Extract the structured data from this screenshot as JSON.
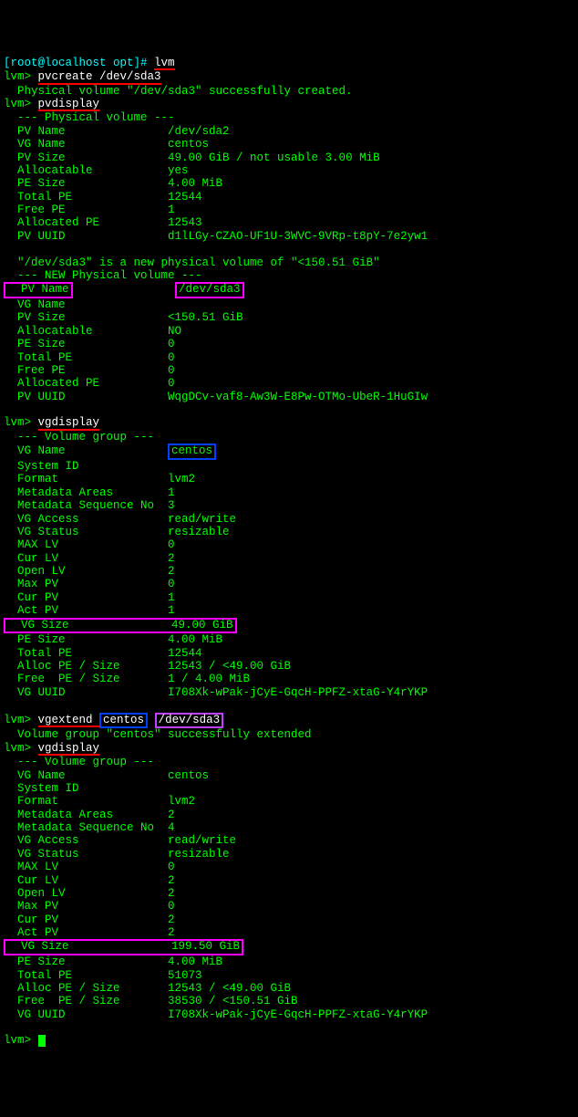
{
  "line1_prompt": "[root@localhost opt]# ",
  "line1_cmd": "lvm",
  "lvm_prompt": "lvm> ",
  "cmd_pvcreate": "pvcreate /dev/sda3",
  "pvcreate_msg": "  Physical volume \"/dev/sda3\" successfully created.",
  "cmd_pvdisplay": "pvdisplay",
  "pv1_header": "  --- Physical volume ---",
  "pv1_name_l": "  PV Name               ",
  "pv1_name_v": "/dev/sda2",
  "pv1_vg_l": "  VG Name               ",
  "pv1_vg_v": "centos",
  "pv1_size_l": "  PV Size               ",
  "pv1_size_v": "49.00 GiB / not usable 3.00 MiB",
  "pv1_alloc_l": "  Allocatable           ",
  "pv1_alloc_v": "yes",
  "pv1_pesize_l": "  PE Size               ",
  "pv1_pesize_v": "4.00 MiB",
  "pv1_totpe_l": "  Total PE              ",
  "pv1_totpe_v": "12544",
  "pv1_freepe_l": "  Free PE               ",
  "pv1_freepe_v": "1",
  "pv1_allocpe_l": "  Allocated PE          ",
  "pv1_allocpe_v": "12543",
  "pv1_uuid_l": "  PV UUID               ",
  "pv1_uuid_v": "d1lLGy-CZAO-UF1U-3WVC-9VRp-t8pY-7e2yw1",
  "pv2_msg": "  \"/dev/sda3\" is a new physical volume of \"<150.51 GiB\"",
  "pv2_header": "  --- NEW Physical volume ---",
  "pv2_name_l1": "  PV Name",
  "pv2_name_pad": "               ",
  "pv2_name_v": "/dev/sda3",
  "pv2_vg_l": "  VG Name               ",
  "pv2_size_l": "  PV Size               ",
  "pv2_size_v": "<150.51 GiB",
  "pv2_alloc_l": "  Allocatable           ",
  "pv2_alloc_v": "NO",
  "pv2_pesize_l": "  PE Size               ",
  "pv2_pesize_v": "0",
  "pv2_totpe_l": "  Total PE              ",
  "pv2_totpe_v": "0",
  "pv2_freepe_l": "  Free PE               ",
  "pv2_freepe_v": "0",
  "pv2_allocpe_l": "  Allocated PE          ",
  "pv2_allocpe_v": "0",
  "pv2_uuid_l": "  PV UUID               ",
  "pv2_uuid_v": "WqgDCv-vaf8-Aw3W-E8Pw-OTMo-UbeR-1HuGIw",
  "cmd_vgdisplay": "vgdisplay",
  "vg_header": "  --- Volume group ---",
  "vg_name_l": "  VG Name               ",
  "vg_name_v": "centos",
  "vg_sysid_l": "  System ID             ",
  "vg_format_l": "  Format                ",
  "vg_format_v": "lvm2",
  "vg_meta_l": "  Metadata Areas        ",
  "vg1_meta_v": "1",
  "vg_seqno_l": "  Metadata Sequence No  ",
  "vg1_seqno_v": "3",
  "vg_access_l": "  VG Access             ",
  "vg_access_v": "read/write",
  "vg_status_l": "  VG Status             ",
  "vg_status_v": "resizable",
  "vg_maxlv_l": "  MAX LV                ",
  "vg_maxlv_v": "0",
  "vg_curlv_l": "  Cur LV                ",
  "vg_curlv_v": "2",
  "vg_openlv_l": "  Open LV               ",
  "vg_openlv_v": "2",
  "vg_maxpv_l": "  Max PV                ",
  "vg_maxpv_v": "0",
  "vg_curpv_l": "  Cur PV                ",
  "vg1_curpv_v": "1",
  "vg_actpv_l": "  Act PV                ",
  "vg1_actpv_v": "1",
  "vg_size_l1": "  VG Size",
  "vg_size_pad": "               ",
  "vg1_size_v": "49.00 GiB",
  "vg_pesize_l": "  PE Size               ",
  "vg_pesize_v": "4.00 MiB",
  "vg_totpe_l": "  Total PE              ",
  "vg1_totpe_v": "12544",
  "vg_allocpe_l": "  Alloc PE / Size       ",
  "vg_allocpe_v": "12543 / <49.00 GiB",
  "vg_freepe_l": "  Free  PE / Size       ",
  "vg1_freepe_v": "1 / 4.00 MiB",
  "vg_uuid_l": "  VG UUID               ",
  "vg_uuid_v": "I708Xk-wPak-jCyE-GqcH-PPFZ-xtaG-Y4rYKP",
  "cmd_vgextend_a": "vgextend ",
  "cmd_vgextend_b": "centos",
  "cmd_vgextend_sp": " ",
  "cmd_vgextend_c": "/dev/sda3",
  "vgextend_msg": "  Volume group \"centos\" successfully extended",
  "vg2_meta_v": "2",
  "vg2_seqno_v": "4",
  "vg2_curpv_v": "2",
  "vg2_actpv_v": "2",
  "vg2_size_v": "199.50 GiB",
  "vg2_totpe_v": "51073",
  "vg2_freepe_v": "38530 / <150.51 GiB",
  "blank": "   "
}
